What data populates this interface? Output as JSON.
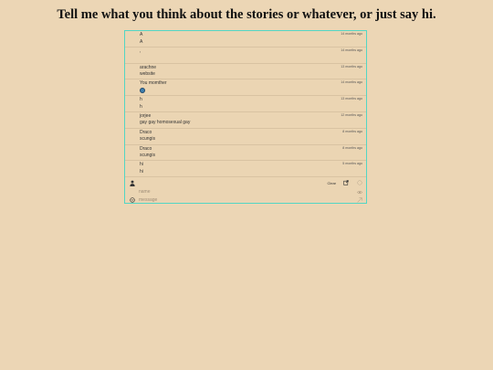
{
  "page": {
    "heading": "Tell me what you think about the stories or whatever, or just say hi."
  },
  "comments": [
    {
      "name": "A",
      "message": "A",
      "time": "14 months ago"
    },
    {
      "name": ",",
      "message": "",
      "time": "14 months ago"
    },
    {
      "name": "arachne",
      "message": "website",
      "time": "13 months ago"
    },
    {
      "name": "You momther",
      "message": "",
      "time": "14 months ago",
      "has_avatar": true
    },
    {
      "name": "h",
      "message": "h",
      "time": "13 months ago"
    },
    {
      "name": "jorjee",
      "message": "gay gay homosexual gay",
      "time": "12 months ago"
    },
    {
      "name": "Draco",
      "message": "scungis",
      "time": "8 months ago"
    },
    {
      "name": "Draco",
      "message": "scungis",
      "time": "8 months ago"
    },
    {
      "name": "hi",
      "message": "hi",
      "time": "5 months ago"
    }
  ],
  "form": {
    "clear_label": "Clear",
    "name_placeholder": "name",
    "message_placeholder": "message"
  },
  "colors": {
    "background": "#ecd6b5",
    "accent_border": "#53d6c4",
    "avatar": "#3f7fae"
  }
}
